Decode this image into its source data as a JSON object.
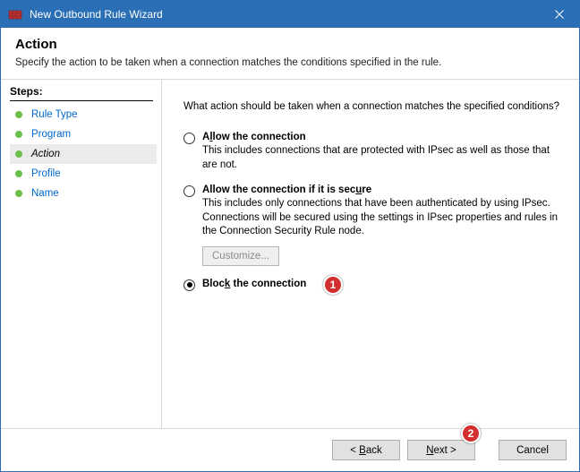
{
  "titlebar": {
    "title": "New Outbound Rule Wizard",
    "close_icon": "×"
  },
  "header": {
    "title": "Action",
    "subtitle": "Specify the action to be taken when a connection matches the conditions specified in the rule."
  },
  "sidebar": {
    "heading": "Steps:",
    "items": [
      {
        "label": "Rule Type",
        "active": false
      },
      {
        "label": "Program",
        "active": false
      },
      {
        "label": "Action",
        "active": true
      },
      {
        "label": "Profile",
        "active": false
      },
      {
        "label": "Name",
        "active": false
      }
    ]
  },
  "main": {
    "question": "What action should be taken when a connection matches the specified conditions?",
    "options": {
      "allow": {
        "pre": "A",
        "u": "l",
        "post": "low the connection",
        "desc": "This includes connections that are protected with IPsec as well as those that are not.",
        "checked": false
      },
      "allow_secure": {
        "pre": "Allow the connection if it is sec",
        "u": "u",
        "post": "re",
        "desc": "This includes only connections that have been authenticated by using IPsec. Connections will be secured using the settings in IPsec properties and rules in the Connection Security Rule node.",
        "checked": false,
        "customize_label": "Customize..."
      },
      "block": {
        "pre": "Bloc",
        "u": "k",
        "post": " the connection",
        "checked": true
      }
    }
  },
  "footer": {
    "back_pre": "< ",
    "back_u": "B",
    "back_post": "ack",
    "next_pre": "",
    "next_u": "N",
    "next_post": "ext >",
    "cancel": "Cancel"
  },
  "annotations": {
    "a1": "1",
    "a2": "2"
  }
}
